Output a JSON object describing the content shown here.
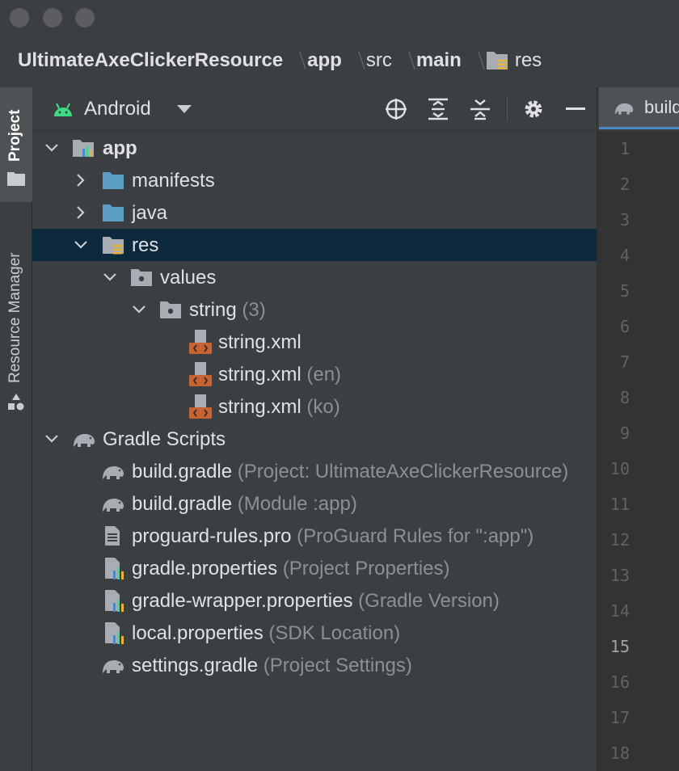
{
  "breadcrumb": {
    "items": [
      {
        "label": "UltimateAxeClickerResource",
        "style": "bold"
      },
      {
        "label": "app",
        "style": "bold"
      },
      {
        "label": "src",
        "style": "plain"
      },
      {
        "label": "main",
        "style": "bold"
      },
      {
        "label": "res",
        "style": "plain",
        "icon": "res-folder-icon"
      }
    ]
  },
  "toolstrip": {
    "project_label": "Project",
    "resource_manager_label": "Resource Manager"
  },
  "project_toolbar": {
    "view_mode": "Android",
    "view_mode_icon": "android-icon",
    "actions": [
      "locate-icon",
      "expand-all-icon",
      "collapse-all-icon",
      "gear-icon",
      "minimize-icon"
    ]
  },
  "editor": {
    "tab_label": "build.gradle",
    "line_numbers": [
      "1",
      "2",
      "3",
      "4",
      "5",
      "6",
      "7",
      "8",
      "9",
      "10",
      "11",
      "12",
      "13",
      "14",
      "15",
      "16",
      "17",
      "18"
    ],
    "current_line": "15"
  },
  "tree": {
    "app": "app",
    "manifests": "manifests",
    "java": "java",
    "res": "res",
    "values": "values",
    "string": "string",
    "string_count": "(3)",
    "string_xml_1": "string.xml",
    "string_xml_2": "string.xml",
    "string_xml_2_hint": "(en)",
    "string_xml_3": "string.xml",
    "string_xml_3_hint": "(ko)",
    "gradle_scripts": "Gradle Scripts",
    "build_gradle_project": "build.gradle",
    "build_gradle_project_hint": "(Project: UltimateAxeClickerResource)",
    "build_gradle_module": "build.gradle",
    "build_gradle_module_hint": "(Module :app)",
    "proguard": "proguard-rules.pro",
    "proguard_hint": "(ProGuard Rules for \":app\")",
    "gradle_properties": "gradle.properties",
    "gradle_properties_hint": "(Project Properties)",
    "gradle_wrapper": "gradle-wrapper.properties",
    "gradle_wrapper_hint": "(Gradle Version)",
    "local_properties": "local.properties",
    "local_properties_hint": "(SDK Location)",
    "settings_gradle": "settings.gradle",
    "settings_gradle_hint": "(Project Settings)"
  },
  "colors": {
    "background": "#3c3f41",
    "selection": "#0d293e",
    "folder": "#5e9dc4",
    "xml": "#c86432",
    "android_green": "#3ddc84",
    "hint_text": "#8c9095"
  }
}
